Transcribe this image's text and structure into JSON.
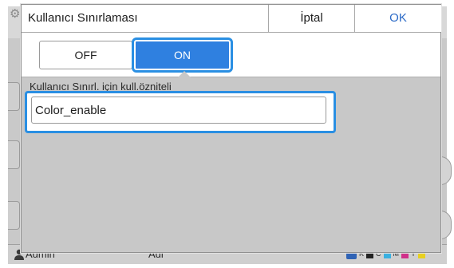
{
  "background": {
    "user_label": "Admin",
    "center_label": "Adi",
    "status_icons": [
      "K",
      "C",
      "M",
      "Y"
    ]
  },
  "dialog": {
    "title": "Kullanıcı Sınırlaması",
    "cancel_label": "İptal",
    "ok_label": "OK",
    "toggle": {
      "off_label": "OFF",
      "on_label": "ON",
      "selected": "ON"
    },
    "field_label": "Kullanıcı Sınırl. için kull.özniteli",
    "field_value": "Color_enable"
  },
  "colors": {
    "accent": "#2f80e0",
    "focus_ring": "#2a8fe3",
    "ok_text": "#2d6bc7",
    "dim_background": "#c8c8c8"
  }
}
